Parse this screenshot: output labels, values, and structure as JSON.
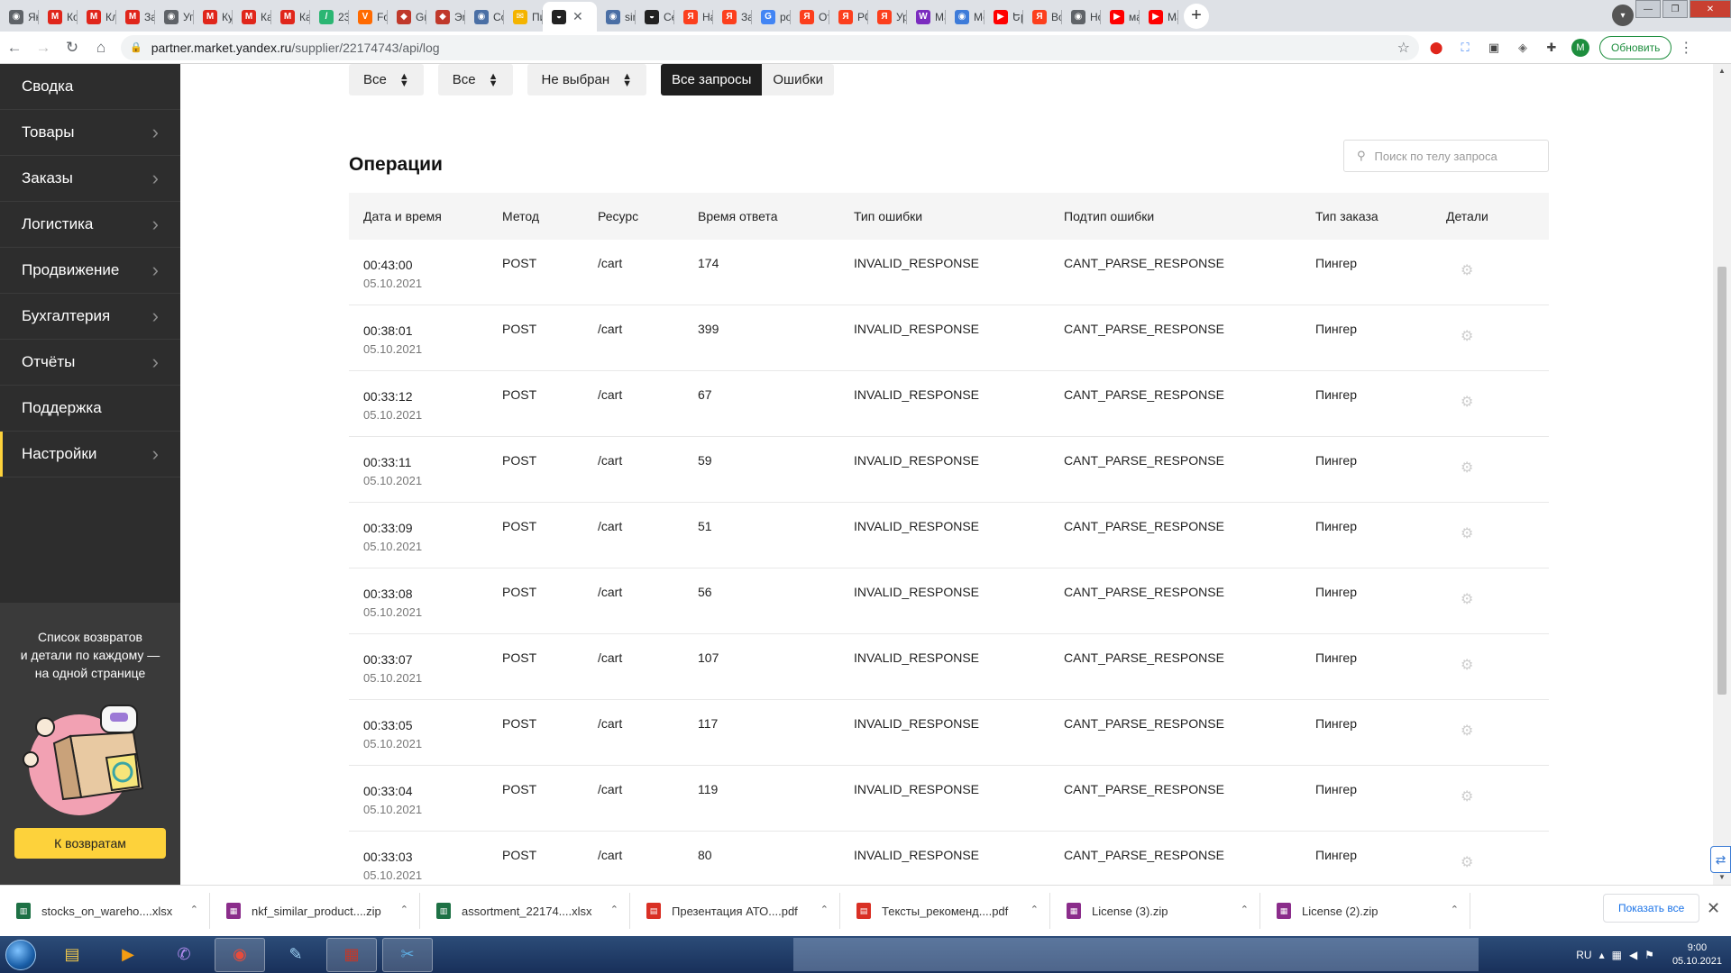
{
  "browser": {
    "tabs": [
      {
        "label": "Ян",
        "color": "#5f6368",
        "glyph": "◉"
      },
      {
        "label": "Ко",
        "color": "#e0261b",
        "glyph": "M"
      },
      {
        "label": "Кл",
        "color": "#e0261b",
        "glyph": "M"
      },
      {
        "label": "За",
        "color": "#e0261b",
        "glyph": "M"
      },
      {
        "label": "Уп",
        "color": "#5f6368",
        "glyph": "◉"
      },
      {
        "label": "Ку",
        "color": "#e0261b",
        "glyph": "M"
      },
      {
        "label": "Ка",
        "color": "#e0261b",
        "glyph": "M"
      },
      {
        "label": "Ка",
        "color": "#e0261b",
        "glyph": "M"
      },
      {
        "label": "23",
        "color": "#2bb673",
        "glyph": "/"
      },
      {
        "label": "Fo",
        "color": "#ff6a00",
        "glyph": "V"
      },
      {
        "label": "Gη",
        "color": "#c0392b",
        "glyph": "◆"
      },
      {
        "label": "Эη",
        "color": "#c0392b",
        "glyph": "◆"
      },
      {
        "label": "Co",
        "color": "#4a6fa5",
        "glyph": "◉"
      },
      {
        "label": "Пи",
        "color": "#f4b400",
        "glyph": "✉"
      },
      {
        "label": "",
        "color": "#222222",
        "glyph": "◒",
        "active": true
      },
      {
        "label": "sin",
        "color": "#4a6fa5",
        "glyph": "◉"
      },
      {
        "label": "Се",
        "color": "#222222",
        "glyph": "◒"
      },
      {
        "label": "На",
        "color": "#fc3f1d",
        "glyph": "Я"
      },
      {
        "label": "За",
        "color": "#fc3f1d",
        "glyph": "Я"
      },
      {
        "label": "po",
        "color": "#4285f4",
        "glyph": "G"
      },
      {
        "label": "От",
        "color": "#fc3f1d",
        "glyph": "Я"
      },
      {
        "label": "РС",
        "color": "#fc3f1d",
        "glyph": "Я"
      },
      {
        "label": "Ур",
        "color": "#fc3f1d",
        "glyph": "Я"
      },
      {
        "label": "Ма",
        "color": "#7b2cbf",
        "glyph": "W"
      },
      {
        "label": "Мс",
        "color": "#3d7bd9",
        "glyph": "◉"
      },
      {
        "label": "Եր",
        "color": "#ff0000",
        "glyph": "▶"
      },
      {
        "label": "Во",
        "color": "#fc3f1d",
        "glyph": "Я"
      },
      {
        "label": "Но",
        "color": "#5f6368",
        "glyph": "◉"
      },
      {
        "label": "ма",
        "color": "#ff0000",
        "glyph": "▶"
      },
      {
        "label": "Ма",
        "color": "#ff0000",
        "glyph": "▶"
      }
    ],
    "new_tab": "+",
    "active_close": "✕",
    "url_host": "partner.market.yandex.ru",
    "url_path": "/supplier/22174743/api/log",
    "update_label": "Обновить",
    "profile_letter": "M"
  },
  "sidebar": {
    "items": [
      {
        "label": "Сводка",
        "chevron": false
      },
      {
        "label": "Товары",
        "chevron": true
      },
      {
        "label": "Заказы",
        "chevron": true
      },
      {
        "label": "Логистика",
        "chevron": true
      },
      {
        "label": "Продвижение",
        "chevron": true
      },
      {
        "label": "Бухгалтерия",
        "chevron": true
      },
      {
        "label": "Отчёты",
        "chevron": true
      },
      {
        "label": "Поддержка",
        "chevron": false
      },
      {
        "label": "Настройки",
        "chevron": true,
        "active": true
      }
    ],
    "promo": {
      "line1": "Список возвратов",
      "line2": "и детали по каждому —",
      "line3": "на одной странице",
      "button": "К возвратам"
    }
  },
  "filters": {
    "select1": "Все",
    "select2": "Все",
    "select3": "Не выбран",
    "seg_all": "Все запросы",
    "seg_errors": "Ошибки"
  },
  "operations": {
    "title": "Операции",
    "search_placeholder": "Поиск по телу запроса",
    "columns": [
      "Дата и время",
      "Метод",
      "Ресурс",
      "Время ответа",
      "Тип ошибки",
      "Подтип ошибки",
      "Тип заказа",
      "Детали"
    ],
    "rows": [
      {
        "time": "00:43:00",
        "date": "05.10.2021",
        "method": "POST",
        "resource": "/cart",
        "response": "174",
        "error": "INVALID_RESPONSE",
        "subtype": "CANT_PARSE_RESPONSE",
        "order": "Пингер"
      },
      {
        "time": "00:38:01",
        "date": "05.10.2021",
        "method": "POST",
        "resource": "/cart",
        "response": "399",
        "error": "INVALID_RESPONSE",
        "subtype": "CANT_PARSE_RESPONSE",
        "order": "Пингер"
      },
      {
        "time": "00:33:12",
        "date": "05.10.2021",
        "method": "POST",
        "resource": "/cart",
        "response": "67",
        "error": "INVALID_RESPONSE",
        "subtype": "CANT_PARSE_RESPONSE",
        "order": "Пингер"
      },
      {
        "time": "00:33:11",
        "date": "05.10.2021",
        "method": "POST",
        "resource": "/cart",
        "response": "59",
        "error": "INVALID_RESPONSE",
        "subtype": "CANT_PARSE_RESPONSE",
        "order": "Пингер"
      },
      {
        "time": "00:33:09",
        "date": "05.10.2021",
        "method": "POST",
        "resource": "/cart",
        "response": "51",
        "error": "INVALID_RESPONSE",
        "subtype": "CANT_PARSE_RESPONSE",
        "order": "Пингер"
      },
      {
        "time": "00:33:08",
        "date": "05.10.2021",
        "method": "POST",
        "resource": "/cart",
        "response": "56",
        "error": "INVALID_RESPONSE",
        "subtype": "CANT_PARSE_RESPONSE",
        "order": "Пингер"
      },
      {
        "time": "00:33:07",
        "date": "05.10.2021",
        "method": "POST",
        "resource": "/cart",
        "response": "107",
        "error": "INVALID_RESPONSE",
        "subtype": "CANT_PARSE_RESPONSE",
        "order": "Пингер"
      },
      {
        "time": "00:33:05",
        "date": "05.10.2021",
        "method": "POST",
        "resource": "/cart",
        "response": "117",
        "error": "INVALID_RESPONSE",
        "subtype": "CANT_PARSE_RESPONSE",
        "order": "Пингер"
      },
      {
        "time": "00:33:04",
        "date": "05.10.2021",
        "method": "POST",
        "resource": "/cart",
        "response": "119",
        "error": "INVALID_RESPONSE",
        "subtype": "CANT_PARSE_RESPONSE",
        "order": "Пингер"
      },
      {
        "time": "00:33:03",
        "date": "05.10.2021",
        "method": "POST",
        "resource": "/cart",
        "response": "80",
        "error": "INVALID_RESPONSE",
        "subtype": "CANT_PARSE_RESPONSE",
        "order": "Пингер"
      }
    ]
  },
  "downloads": {
    "items": [
      {
        "name": "stocks_on_wareho....xlsx",
        "type": "xlsx",
        "color": "#1e7145"
      },
      {
        "name": "nkf_similar_product....zip",
        "type": "zip",
        "color": "#8b2d8b"
      },
      {
        "name": "assortment_22174....xlsx",
        "type": "xlsx",
        "color": "#1e7145"
      },
      {
        "name": "Презентация АТО....pdf",
        "type": "pdf",
        "color": "#d93025"
      },
      {
        "name": "Тексты_рекоменд....pdf",
        "type": "pdf",
        "color": "#d93025"
      },
      {
        "name": "License (3).zip",
        "type": "zip",
        "color": "#8b2d8b"
      },
      {
        "name": "License (2).zip",
        "type": "zip",
        "color": "#8b2d8b"
      }
    ],
    "show_all": "Показать все"
  },
  "taskbar": {
    "lang": "RU",
    "time": "9:00",
    "date": "05.10.2021"
  },
  "colors": {
    "sidebar_bg": "#2d2d2d",
    "accent_yellow": "#fdd23b",
    "segment_active": "#1f1f1f"
  }
}
